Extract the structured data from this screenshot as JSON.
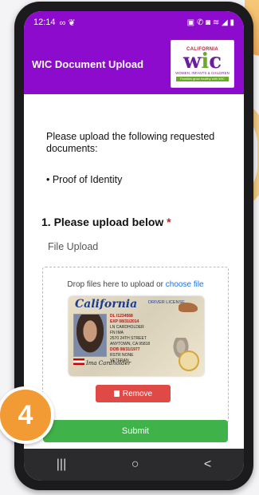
{
  "status": {
    "time": "12:14",
    "left_icons": "∞ ❦",
    "right_icons": "▣ ✆ ◙ ≋ ◢ ▮"
  },
  "app": {
    "title": "WIC Document Upload"
  },
  "logo": {
    "top": "CALIFORNIA",
    "main_w": "w",
    "main_i": "i",
    "main_c": "c",
    "sub": "WOMEN, INFANTS & CHILDREN",
    "tag": "Families grow healthy with WIC"
  },
  "intro": "Please upload the following requested documents:",
  "doc_item": "• Proof of Identity",
  "section": {
    "title": "1. Please upload below",
    "required": "*"
  },
  "upload": {
    "label": "File Upload",
    "drop_text": "Drop files here to upload or ",
    "choose": "choose file"
  },
  "license": {
    "state": "California",
    "type": "DRIVER LICENSE",
    "lines": [
      "DL I1234568",
      "EXP 08/31/2014",
      "LN CARDHOLDER",
      "FN IMA",
      "2570 24TH STREET",
      "ANYTOWN, CA 95818",
      "DOB 08/31/1977",
      "RSTR NONE",
      "VETERAN"
    ],
    "signature": "Ima Cardholder"
  },
  "remove": {
    "label": "Remove"
  },
  "submit": {
    "label": "Submit"
  },
  "nav": {
    "recent": "|||",
    "home": "○",
    "back": "<"
  },
  "badge": {
    "number": "4"
  },
  "colors": {
    "primary": "#8d0bcc",
    "submit": "#3fb24a",
    "remove": "#e04a46",
    "badge": "#f29a33",
    "link": "#1a73e8"
  }
}
